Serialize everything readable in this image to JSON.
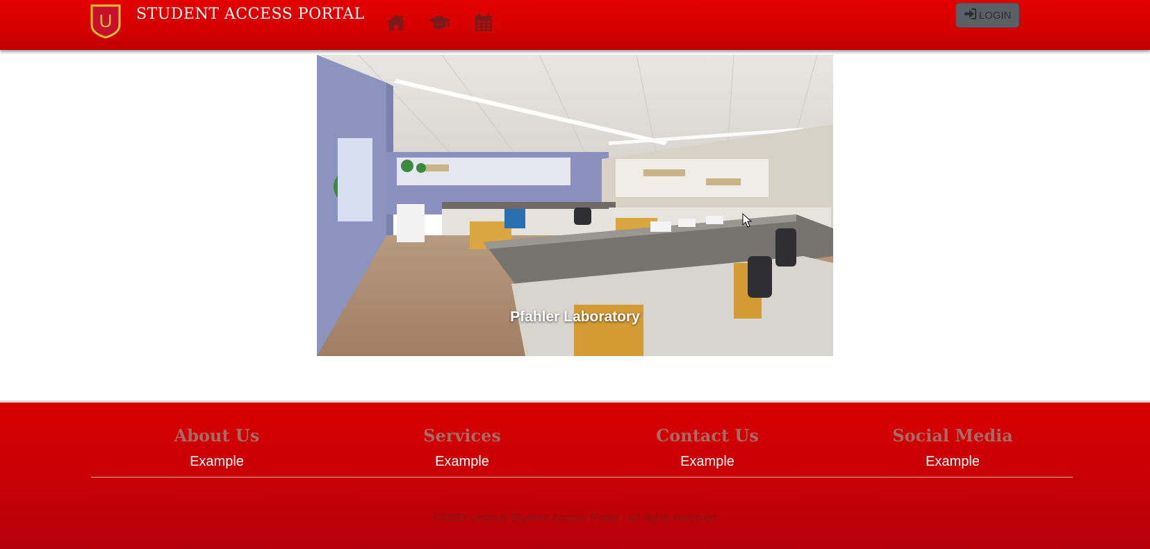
{
  "header": {
    "logo_letter": "U",
    "title": "STUDENT ACCESS PORTAL",
    "nav_icons": [
      "home-icon",
      "graduation-cap-icon",
      "calendar-icon"
    ],
    "login_label": "LOGIN",
    "colors": {
      "bar": "#d40000",
      "logo_fill": "#c8102e",
      "logo_border": "#f2c230",
      "button": "#5b5f66"
    }
  },
  "hero": {
    "caption": "Pfahler Laboratory"
  },
  "footer": {
    "columns": [
      {
        "heading": "About Us",
        "link": "Example"
      },
      {
        "heading": "Services",
        "link": "Example"
      },
      {
        "heading": "Contact Us",
        "link": "Example"
      },
      {
        "heading": "Social Media",
        "link": "Example"
      }
    ],
    "copyright": "©2023 Ursinus Student Access Portal | All rights reserved"
  }
}
